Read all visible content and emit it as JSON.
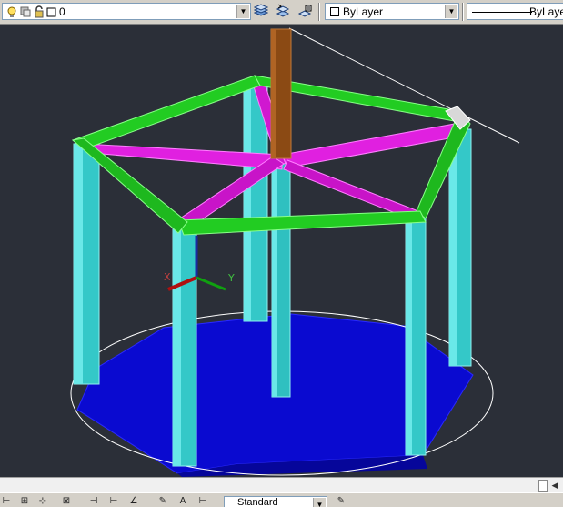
{
  "layer_toolbar": {
    "current_layer": "0",
    "icons": [
      "lightbulb-icon",
      "freeze-sun-icon",
      "lock-icon",
      "layer-color-icon"
    ],
    "layer_manager_icons": [
      "make-current-layer-icon",
      "layer-previous-icon",
      "layer-states-icon"
    ]
  },
  "properties_toolbar": {
    "color_value": "ByLayer",
    "linetype_value": "ByLayer"
  },
  "bottom_toolbar": {
    "text_style_value": "Standard",
    "icons": [
      "dimension-linear-icon",
      "dimension-aligned-icon",
      "dimension-angular-icon",
      "text-icon",
      "dimension-style-icon"
    ]
  },
  "ucs": {
    "x_label": "X",
    "y_label": "Y"
  },
  "colors": {
    "toolbar_bg": "#d4d0c8",
    "viewport_bg": "#2b2f38",
    "beams_green": "#22cc22",
    "rafters_magenta": "#e020e0",
    "columns_cyan": "#40d8d8",
    "base_blue": "#0a0ad0",
    "center_post_brown": "#8b4a14",
    "outline_white": "#ffffff"
  }
}
